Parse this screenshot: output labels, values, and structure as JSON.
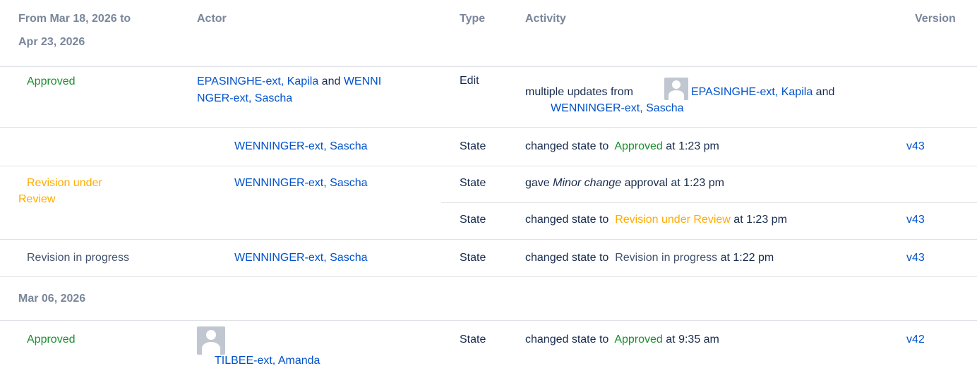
{
  "header": {
    "period_line1": "From Mar 18, 2026 to",
    "period_line2": "Apr 23, 2026",
    "actor": "Actor",
    "type": "Type",
    "activity": "Activity",
    "version": "Version"
  },
  "rows": [
    {
      "state": "Approved",
      "actor_line1_a": "EPASINGHE-ext, Kapila",
      "actor_and": "and",
      "actor_line1_b": "WENNI",
      "actor_line2": "NGER-ext, Sascha",
      "type": "Edit",
      "activity_prefix": "multiple updates from",
      "activity_user1": "EPASINGHE-ext, Kapila",
      "activity_and": "and",
      "activity_user2": "WENNINGER-ext, Sascha"
    },
    {
      "actor": "WENNINGER-ext, Sascha",
      "type": "State",
      "activity_prefix": "changed state to",
      "activity_state": "Approved",
      "activity_suffix": "at 1:23 pm",
      "version": "v43"
    },
    {
      "state_line1": "Revision under",
      "state_line2": "Review",
      "actor": "WENNINGER-ext, Sascha",
      "sub": [
        {
          "type": "State",
          "activity_prefix": "gave",
          "activity_em": "Minor change",
          "activity_suffix": "approval at 1:23 pm"
        },
        {
          "type": "State",
          "activity_prefix": "changed state to",
          "activity_state": "Revision under Review",
          "activity_suffix": "at 1:23 pm",
          "version": "v43"
        }
      ]
    },
    {
      "state": "Revision in progress",
      "actor": "WENNINGER-ext, Sascha",
      "type": "State",
      "activity_prefix": "changed state to",
      "activity_state": "Revision in progress",
      "activity_suffix": "at 1:22 pm",
      "version": "v43"
    }
  ],
  "group2": {
    "date": "Mar 06, 2026",
    "row": {
      "state": "Approved",
      "actor": "TILBEE-ext, Amanda",
      "type": "State",
      "activity_prefix": "changed state to",
      "activity_state": "Approved",
      "activity_suffix": "at 9:35 am",
      "version": "v42"
    }
  },
  "colors": {
    "link": "#0052cc",
    "approved": "#1a8f2e",
    "review": "#ffab00",
    "in_progress": "#42526e",
    "header": "#7a869a",
    "divider": "#dfe1e6"
  },
  "icons": [
    "user-avatar-icon"
  ]
}
